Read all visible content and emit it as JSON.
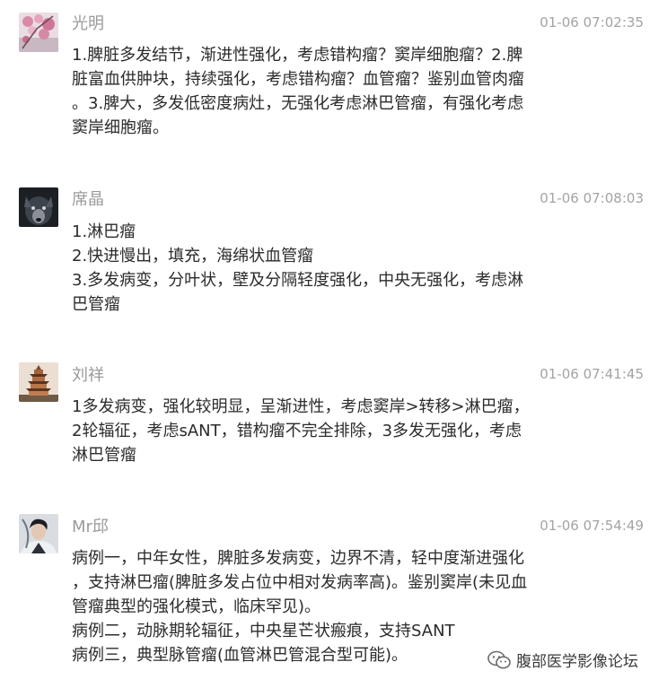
{
  "comments": [
    {
      "name": "光明",
      "time": "01-06 07:02:35",
      "avatar": "pink-blossom-avatar",
      "lines": [
        "1.脾脏多发结节，渐进性强化，考虑错构瘤？窦岸细胞瘤？2.脾",
        "脏富血供肿块，持续强化，考虑错构瘤？血管瘤？鉴别血管肉瘤",
        "。3.脾大，多发低密度病灶，无强化考虑淋巴管瘤，有强化考虑",
        "窦岸细胞瘤。"
      ]
    },
    {
      "name": "席晶",
      "time": "01-06 07:08:03",
      "avatar": "wolf-avatar",
      "lines": [
        "1.淋巴瘤",
        "2.快进慢出，填充，海绵状血管瘤",
        "3.多发病变，分叶状，壁及分隔轻度强化，中央无强化，考虑淋",
        "巴管瘤"
      ]
    },
    {
      "name": "刘祥",
      "time": "01-06 07:41:45",
      "avatar": "pagoda-avatar",
      "lines": [
        "1多发病变，强化较明显，呈渐进性，考虑窦岸>转移>淋巴瘤，",
        "2轮辐征，考虑sANT，错构瘤不完全排除，3多发无强化，考虑",
        "淋巴管瘤"
      ]
    },
    {
      "name": "Mr邱",
      "time": "01-06 07:54:49",
      "avatar": "person-portrait-avatar",
      "lines": [
        "病例一，中年女性，脾脏多发病变，边界不清，轻中度渐进强化",
        "，支持淋巴瘤(脾脏多发占位中相对发病率高)。鉴别窦岸(未见血",
        "管瘤典型的强化模式，临床罕见)。",
        "病例二，动脉期轮辐征，中央星芒状瘢痕，支持SANT",
        "病例三，典型脉管瘤(血管淋巴管混合型可能)。"
      ]
    }
  ],
  "watermark": {
    "icon": "wechat-official-account-icon",
    "text": "腹部医学影像论坛"
  }
}
